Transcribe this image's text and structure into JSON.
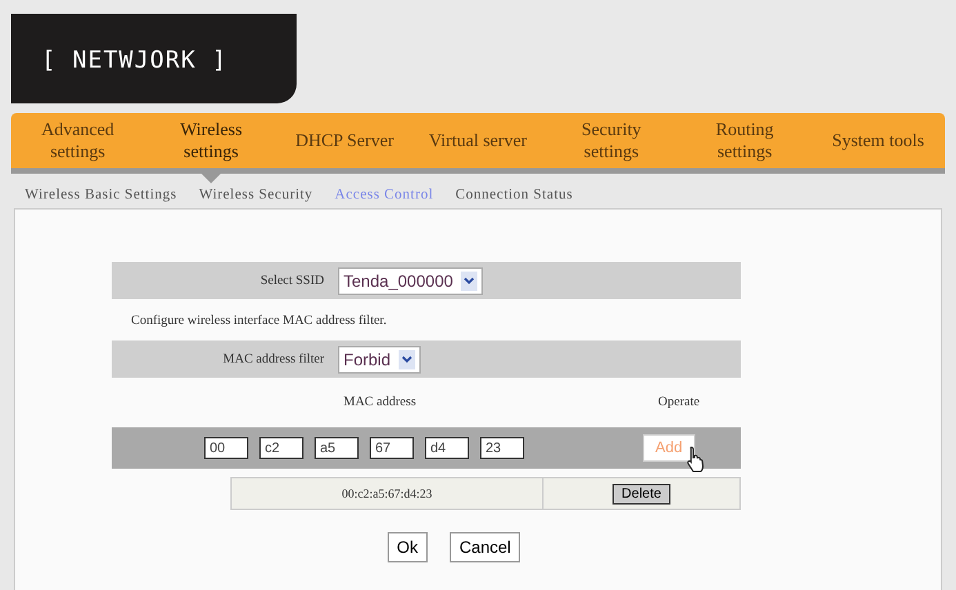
{
  "logo": "[ NETWJORK ]",
  "nav": [
    {
      "label": "Advanced settings",
      "selected": false
    },
    {
      "label": "Wireless settings",
      "selected": true
    },
    {
      "label": "DHCP Server",
      "selected": false
    },
    {
      "label": "Virtual server",
      "selected": false
    },
    {
      "label": "Security settings",
      "selected": false
    },
    {
      "label": "Routing settings",
      "selected": false
    },
    {
      "label": "System tools",
      "selected": false
    }
  ],
  "subnav": [
    {
      "label": "Wireless Basic Settings",
      "selected": false
    },
    {
      "label": "Wireless Security",
      "selected": false
    },
    {
      "label": "Access Control",
      "selected": true
    },
    {
      "label": "Connection Status",
      "selected": false
    }
  ],
  "ssid": {
    "label": "Select SSID",
    "value": "Tenda_000000"
  },
  "description": "Configure wireless interface MAC address filter.",
  "filter": {
    "label": "MAC address filter",
    "value": "Forbid"
  },
  "table": {
    "columns": [
      "MAC address",
      "Operate"
    ],
    "octets": [
      "00",
      "c2",
      "a5",
      "67",
      "d4",
      "23"
    ],
    "add_button": "Add",
    "rows": [
      {
        "mac": "00:c2:a5:67:d4:23",
        "action": "Delete"
      }
    ]
  },
  "buttons": [
    "Ok",
    "Cancel"
  ]
}
